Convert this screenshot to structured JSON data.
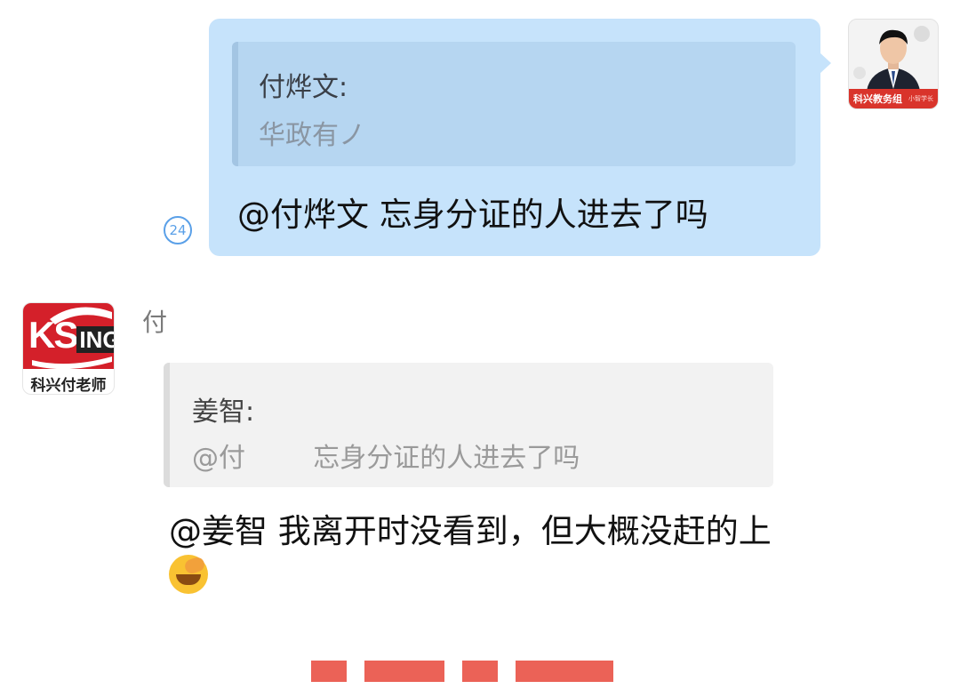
{
  "outgoing": {
    "quote": {
      "author": "付烨文:",
      "text": "华政有ノ"
    },
    "message": "@付烨文 忘身分证的人进去了吗",
    "read_count": "24"
  },
  "my_avatar": {
    "icon": "person-photo",
    "banner": "科兴教务组",
    "sub": "小智学长"
  },
  "incoming": {
    "sender_name": "付",
    "avatar": {
      "logo": "KSING",
      "caption": "科兴付老师"
    },
    "quote": {
      "author": "姜智:",
      "text": "@付        忘身分证的人进去了吗"
    },
    "message": "@姜智 我离开时没看到，但大概没赶的上",
    "emoji": "face-with-hand-over-mouth-icon"
  },
  "colors": {
    "outgoing_bubble": "#c6e3fb",
    "incoming_quote": "#f2f2f2",
    "read_badge": "#5aa0e8",
    "brand_red": "#d4202a"
  }
}
